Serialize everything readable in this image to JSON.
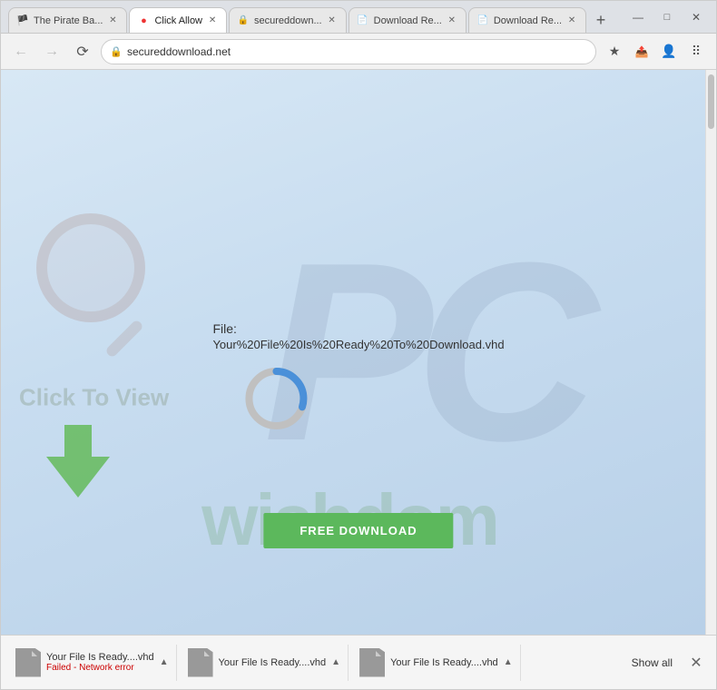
{
  "browser": {
    "tabs": [
      {
        "id": "tab1",
        "label": "The Pirate Ba...",
        "icon": "🏴",
        "active": false,
        "closable": true
      },
      {
        "id": "tab2",
        "label": "Click Allow",
        "icon": "🔴",
        "active": true,
        "closable": true
      },
      {
        "id": "tab3",
        "label": "secureddown...",
        "icon": "🔒",
        "active": false,
        "closable": true
      },
      {
        "id": "tab4",
        "label": "Download Re...",
        "icon": "📄",
        "active": false,
        "closable": true
      },
      {
        "id": "tab5",
        "label": "Download Re...",
        "icon": "📄",
        "active": false,
        "closable": true
      }
    ],
    "new_tab_icon": "+",
    "address_bar": {
      "url": "secureddownload.net",
      "lock_icon": "🔒"
    },
    "window_controls": {
      "minimize": "—",
      "maximize": "□",
      "close": "✕"
    }
  },
  "page": {
    "watermark_pc": "PC",
    "click_to_view": "Click To View",
    "file_section": {
      "label": "File:",
      "filename": "Your%20File%20Is%20Ready%20To%20Download.vhd"
    },
    "progress_ring": {
      "radius": 30,
      "stroke": 8,
      "percent": 30,
      "color_track": "#c0c0c0",
      "color_progress": "#4a90d9"
    },
    "download_button": "FREE DOWNLOAD",
    "wishdom_watermark": "wishdom"
  },
  "download_bar": {
    "items": [
      {
        "name": "Your File Is Ready....vhd",
        "status": "Failed - Network error",
        "has_chevron": true
      },
      {
        "name": "Your File Is Ready....vhd",
        "status": "",
        "has_chevron": true
      },
      {
        "name": "Your File Is Ready....vhd",
        "status": "",
        "has_chevron": true
      }
    ],
    "show_all": "Show all",
    "close_icon": "✕"
  }
}
